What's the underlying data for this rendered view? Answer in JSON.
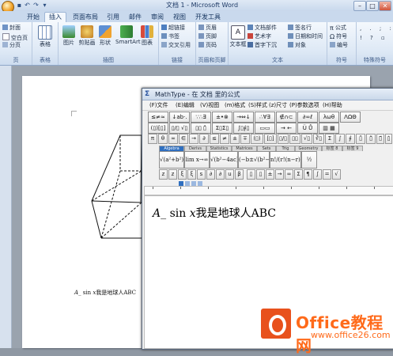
{
  "word": {
    "title": "文档 1 - Microsoft Word",
    "tabs": [
      "开始",
      "插入",
      "页面布局",
      "引用",
      "邮件",
      "审阅",
      "视图",
      "开发工具"
    ],
    "active_tab": "插入",
    "groups": {
      "pages": {
        "label": "页",
        "items": [
          "封面",
          "空白页",
          "分页"
        ]
      },
      "tables": {
        "label": "表格",
        "button": "表格"
      },
      "illustrations": {
        "label": "插图",
        "buttons": [
          "图片",
          "剪贴画",
          "形状",
          "SmartArt",
          "图表"
        ]
      },
      "links": {
        "label": "链接",
        "items": [
          "超链接",
          "书签",
          "交叉引用"
        ]
      },
      "header_footer": {
        "label": "页眉和页脚",
        "items": [
          "页眉",
          "页脚",
          "页码"
        ]
      },
      "text": {
        "label": "文本",
        "textbox": "文本框",
        "items": [
          "文档部件",
          "艺术字",
          "首字下沉",
          "签名行",
          "日期和时间",
          "对象"
        ]
      },
      "symbols": {
        "label": "符号",
        "items": [
          "公式",
          "符号",
          "编号"
        ]
      },
      "special": {
        "label": "特殊符号"
      }
    },
    "page_formula": {
      "var": "A",
      "rest": "_ sin",
      "var2": "x",
      "text": "我是地球人ABC"
    }
  },
  "mathtype": {
    "title": "MathType - 在 文档  里的公式",
    "menu": [
      "(F)文件",
      "(E)编辑",
      "(V)视图",
      "(m)格式",
      "(S)样式",
      "(z)尺寸",
      "(P)参数选项",
      "(H)帮助"
    ],
    "row1": [
      "≤≠≈",
      "↓ab·.",
      "∵∴∃",
      "±•⊗",
      "→⇔↓",
      "∴∀∃",
      "∉∩⊂",
      "∂∞ℓ",
      "λωθ",
      "ΛΩΘ"
    ],
    "row2": [
      "(▯)[▯]",
      "▯/▯ √▯",
      "▯▯ ▯̂",
      "Σ▯Σ▯",
      "∫▯∮▯",
      "▭▭",
      "→ ←",
      "Ü Ů",
      "▥ ▦"
    ],
    "row3": [
      "π",
      "θ",
      "∞",
      "∈",
      "→",
      "∂",
      "≤",
      "≠",
      "±",
      "∓",
      "(▯)",
      "[▯]",
      "▯/▯",
      "▯▯",
      "√▯",
      "∛▯",
      "Σ",
      "∫",
      "∮",
      "▯̄",
      "▯̃",
      "▯⃗",
      "▯̇"
    ],
    "tabs": [
      "Algebra",
      "Derivs",
      "Statistics",
      "Matrices",
      "Sets",
      "Trig",
      "Geometry",
      "标签 8",
      "标签 9"
    ],
    "big": [
      "√(a²+b²)",
      "lim x→∞",
      "√(b²−4ac)",
      "(−b±√(b²−4ac))/2a",
      "n!/(r!(n−r)!)",
      "½"
    ],
    "row5": [
      "z",
      "z",
      "ξ",
      "ξ",
      "s",
      "∂",
      "∂",
      "u",
      "β"
    ],
    "row6": [
      "▯",
      "▯",
      "±",
      "→",
      "∞",
      "Σ",
      "¶",
      "∫",
      "=",
      "√"
    ],
    "formula": {
      "var": "A",
      "rest": "_ sin ",
      "var2": "x",
      "text": "我是地球人ABC"
    }
  },
  "watermark": {
    "name": "Office教程网",
    "url": "www.office26.com"
  }
}
